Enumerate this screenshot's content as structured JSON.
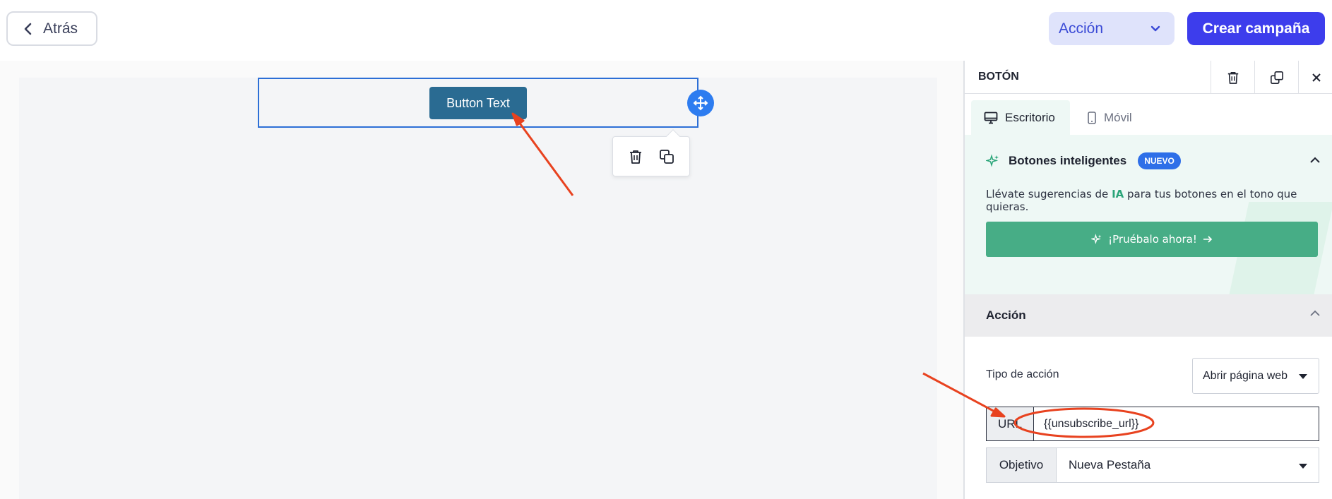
{
  "topbar": {
    "back_label": "Atrás",
    "action_label": "Acción",
    "create_label": "Crear campaña"
  },
  "canvas": {
    "button_text": "Button Text"
  },
  "panel": {
    "title": "BOTÓN",
    "tabs": [
      {
        "label": "Escritorio",
        "active": true
      },
      {
        "label": "Móvil",
        "active": false
      }
    ],
    "smart_buttons": {
      "title": "Botones inteligentes",
      "badge": "NUEVO",
      "desc_before": "Llévate sugerencias de ",
      "desc_highlight": "IA",
      "desc_after": " para tus botones en el tono que quieras.",
      "cta": "¡Pruébalo ahora!"
    },
    "action_section": {
      "title": "Acción",
      "type_label": "Tipo de acción",
      "type_value": "Abrir página web",
      "url_label": "URL",
      "url_value": "{{unsubscribe_url}}",
      "target_label": "Objetivo",
      "target_value": "Nueva Pestaña"
    }
  },
  "colors": {
    "primary": "#3d3dec",
    "selection": "#2d6fd6",
    "smart_green": "#47ad86",
    "annotation": "#e8421f"
  }
}
